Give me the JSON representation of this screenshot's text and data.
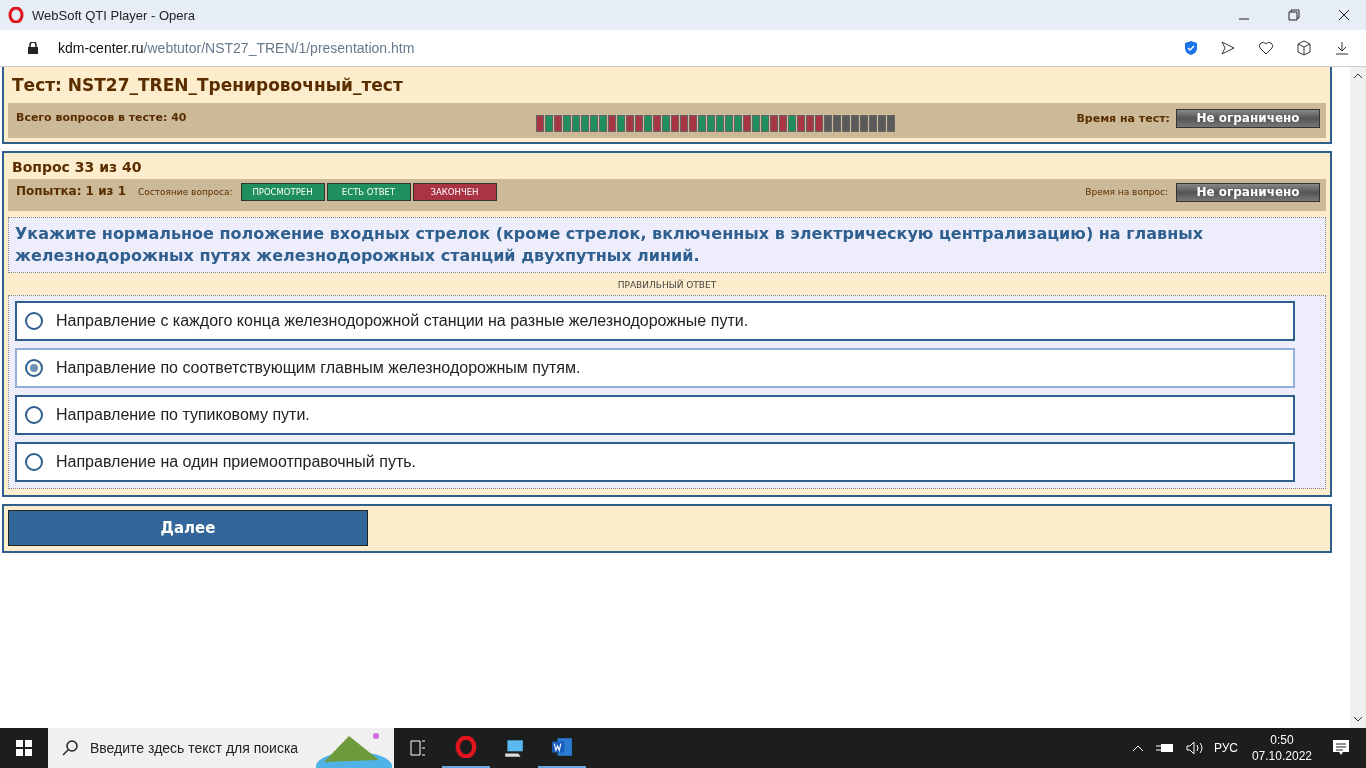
{
  "window": {
    "title": "WebSoft QTI Player - Opera"
  },
  "address": {
    "domain": "kdm-center.ru",
    "path": "/webtutor/NST27_TREN/1/presentation.htm"
  },
  "test": {
    "title": "Тест: NST27_TREN_Тренировочный_тест",
    "total_label": "Всего вопросов в тесте: 40",
    "time_label": "Время на тест:",
    "time_value": "Не ограничено",
    "progress": [
      {
        "color": "#a83444"
      },
      {
        "color": "#1f8f5f"
      },
      {
        "color": "#a83444"
      },
      {
        "color": "#1f8f5f"
      },
      {
        "color": "#1f8f5f"
      },
      {
        "color": "#1f8f5f"
      },
      {
        "color": "#1f8f5f"
      },
      {
        "color": "#1f8f5f"
      },
      {
        "color": "#a83444"
      },
      {
        "color": "#1f8f5f"
      },
      {
        "color": "#a83444"
      },
      {
        "color": "#a83444"
      },
      {
        "color": "#1f8f5f"
      },
      {
        "color": "#a83444"
      },
      {
        "color": "#1f8f5f"
      },
      {
        "color": "#a83444"
      },
      {
        "color": "#a83444"
      },
      {
        "color": "#a83444"
      },
      {
        "color": "#1f8f5f"
      },
      {
        "color": "#1f8f5f"
      },
      {
        "color": "#1f8f5f"
      },
      {
        "color": "#1f8f5f"
      },
      {
        "color": "#1f8f5f"
      },
      {
        "color": "#a83444"
      },
      {
        "color": "#1f8f5f"
      },
      {
        "color": "#1f8f5f"
      },
      {
        "color": "#a83444"
      },
      {
        "color": "#a83444"
      },
      {
        "color": "#1f8f5f"
      },
      {
        "color": "#a83444"
      },
      {
        "color": "#a83444"
      },
      {
        "color": "#a83444"
      },
      {
        "color": "#5a5a5a"
      },
      {
        "color": "#5a5a5a"
      },
      {
        "color": "#5a5a5a"
      },
      {
        "color": "#5a5a5a"
      },
      {
        "color": "#5a5a5a"
      },
      {
        "color": "#5a5a5a"
      },
      {
        "color": "#5a5a5a"
      },
      {
        "color": "#5a5a5a"
      }
    ]
  },
  "question": {
    "title": "Вопрос 33 из 40",
    "attempt": "Попытка: 1 из 1",
    "state_label": "Состояние вопроса:",
    "states": [
      {
        "label": "ПРОСМОТРЕН",
        "color": "#1f8f5f"
      },
      {
        "label": "ЕСТЬ ОТВЕТ",
        "color": "#1f8f5f"
      },
      {
        "label": "ЗАКОНЧЕН",
        "color": "#a83444"
      }
    ],
    "time_label": "Время на вопрос:",
    "time_value": "Не ограничено",
    "text": "Укажите нормальное положение входных стрелок (кроме стрелок, включенных в электрическую централизацию) на главных железнодорожных путях железнодорожных станций двухпутных линий.",
    "hint": "ПРАВИЛЬНЫЙ ОТВЕТ",
    "answers": [
      {
        "label": "Направление с каждого конца железнодорожной станции на разные железнодорожные пути.",
        "selected": false
      },
      {
        "label": "Направление по соответствующим главным железнодорожным путям.",
        "selected": true
      },
      {
        "label": "Направление по тупиковому пути.",
        "selected": false
      },
      {
        "label": "Направление на один приемоотправочный путь.",
        "selected": false
      }
    ]
  },
  "next_button": "Далее",
  "taskbar": {
    "search_placeholder": "Введите здесь текст для поиска",
    "language": "РУС",
    "time": "0:50",
    "date": "07.10.2022"
  }
}
